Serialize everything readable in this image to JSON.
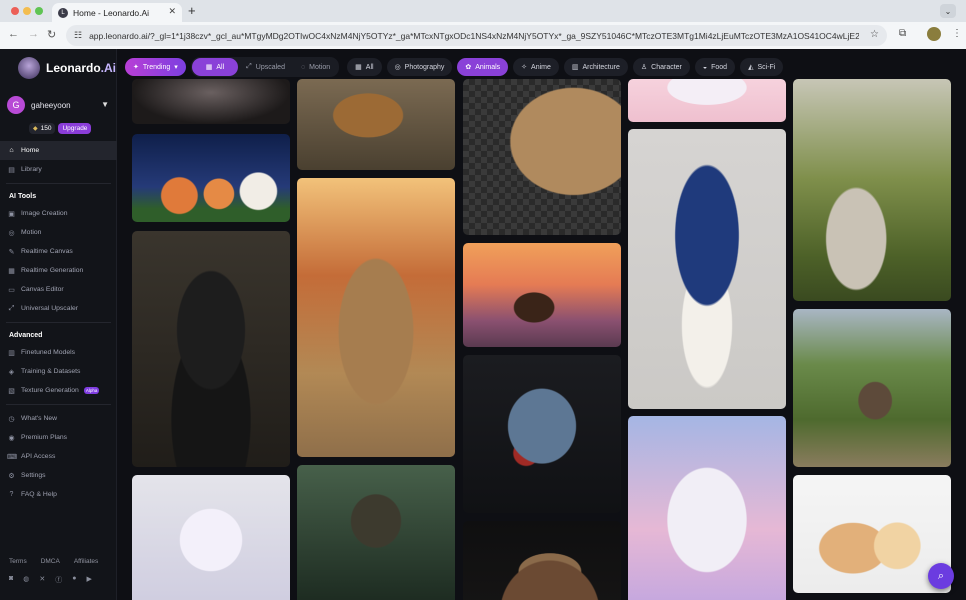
{
  "browser": {
    "tab_title": "Home - Leonardo.Ai",
    "url": "app.leonardo.ai/?_gl=1*1j38czv*_gcl_au*MTgyMDg2OTIwOC4xNzM4NjY5OTYz*_ga*MTcxNTgxODc1NS4xNzM4NjY5OTYx*_ga_9SZY51046C*MTczOTE3MTg1Mi4zLjEuMTczOTE3MzA1OS41OC4wLjE2MTUx..."
  },
  "app": {
    "logo_main": "Leonardo",
    "logo_suffix": ".Ai",
    "user": {
      "initial": "G",
      "name": "gaheeyoon",
      "tokens": "150",
      "upgrade_label": "Upgrade"
    },
    "nav_main": [
      {
        "label": "Home",
        "icon": "home-icon"
      },
      {
        "label": "Library",
        "icon": "library-icon"
      }
    ],
    "ai_tools_title": "AI Tools",
    "ai_tools": [
      {
        "label": "Image Creation",
        "icon": "image-icon"
      },
      {
        "label": "Motion",
        "icon": "motion-icon"
      },
      {
        "label": "Realtime Canvas",
        "icon": "canvas-icon"
      },
      {
        "label": "Realtime Generation",
        "icon": "realtime-icon"
      },
      {
        "label": "Canvas Editor",
        "icon": "editor-icon"
      },
      {
        "label": "Universal Upscaler",
        "icon": "upscaler-icon"
      }
    ],
    "advanced_title": "Advanced",
    "advanced": [
      {
        "label": "Finetuned Models",
        "icon": "models-icon"
      },
      {
        "label": "Training & Datasets",
        "icon": "training-icon"
      },
      {
        "label": "Texture Generation",
        "icon": "texture-icon",
        "badge": "Alpha"
      }
    ],
    "nav_bottom": [
      {
        "label": "What's New",
        "icon": "news-icon"
      },
      {
        "label": "Premium Plans",
        "icon": "premium-icon"
      },
      {
        "label": "API Access",
        "icon": "api-icon"
      },
      {
        "label": "Settings",
        "icon": "settings-icon"
      },
      {
        "label": "FAQ & Help",
        "icon": "help-icon"
      }
    ],
    "footer_links": [
      "Terms",
      "DMCA",
      "Affiliates"
    ]
  },
  "filters": {
    "sort": "Trending",
    "media": [
      "All",
      "Upscaled",
      "Motion"
    ],
    "categories": [
      "All",
      "Photography",
      "Animals",
      "Anime",
      "Architecture",
      "Character",
      "Food",
      "Sci-Fi"
    ],
    "selected_category": "Animals"
  },
  "colors": {
    "accent": "#8a41d8",
    "background": "#0e0f14",
    "sidebar": "#121419"
  }
}
